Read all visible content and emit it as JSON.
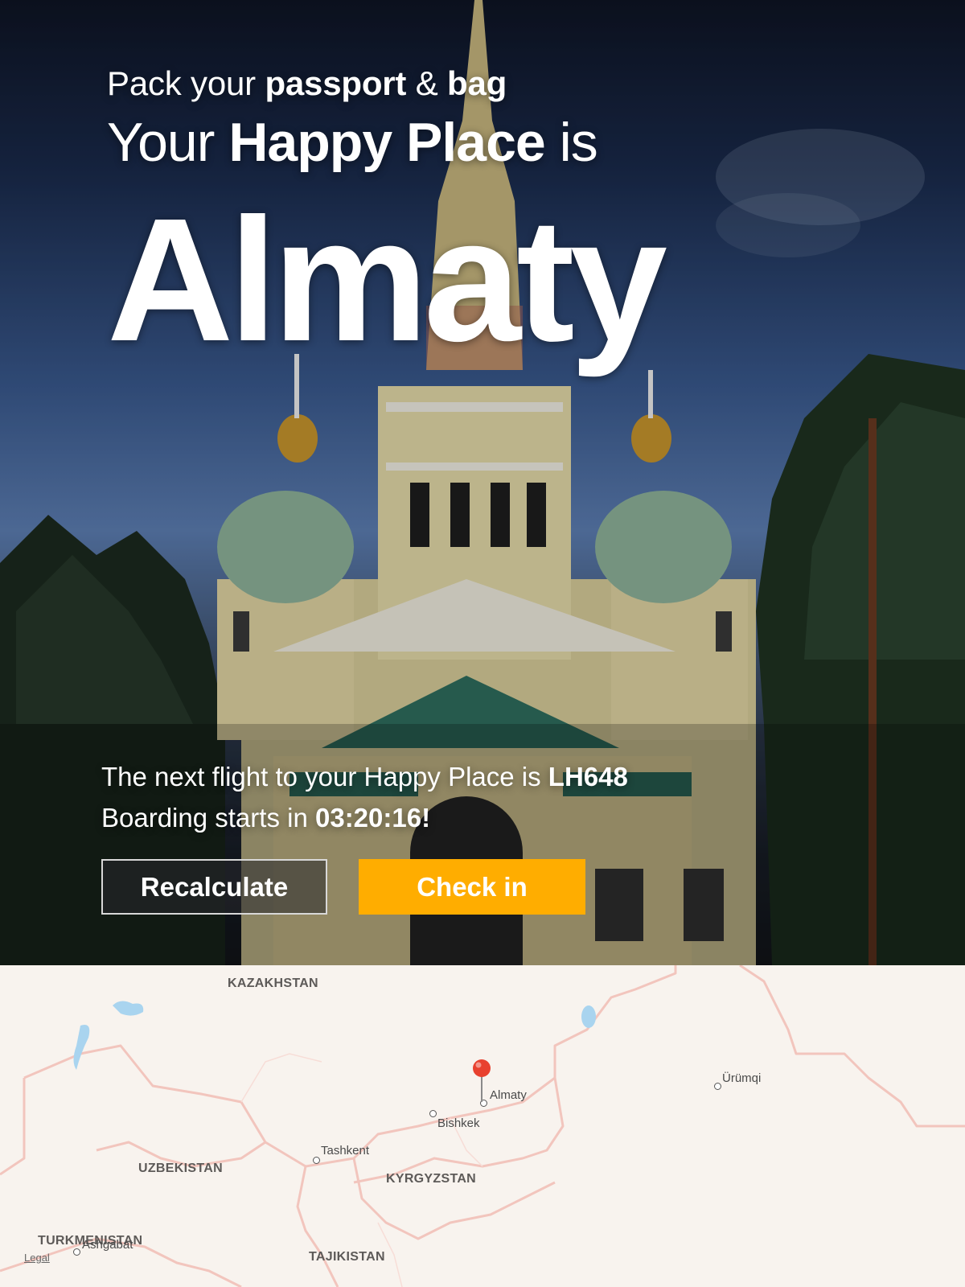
{
  "hero": {
    "tagline_pre": "Pack your",
    "tagline_bold1": "passport",
    "tagline_mid": "&",
    "tagline_bold2": "bag",
    "headline_pre": "Your",
    "headline_bold": "Happy Place",
    "headline_post": "is",
    "city": "Almaty",
    "flight_line_pre": "The next flight to your Happy Place is",
    "flight_number": "LH648",
    "boarding_pre": "Boarding starts in",
    "boarding_countdown": "03:20:16",
    "boarding_post": "!"
  },
  "actions": {
    "recalculate_label": "Recalculate",
    "checkin_label": "Check in"
  },
  "map": {
    "countries": {
      "kazakhstan": "KAZAKHSTAN",
      "uzbekistan": "UZBEKISTAN",
      "kyrgyzstan": "KYRGYZSTAN",
      "turkmenistan": "TURKMENISTAN",
      "tajikistan": "TAJIKISTAN"
    },
    "cities": {
      "almaty": "Almaty",
      "bishkek": "Bishkek",
      "tashkent": "Tashkent",
      "urumqi": "Ürümqi",
      "ashgabat": "Ashgabat"
    },
    "legal": "Legal"
  },
  "colors": {
    "accent": "#ffad00",
    "pin": "#e8412f"
  }
}
